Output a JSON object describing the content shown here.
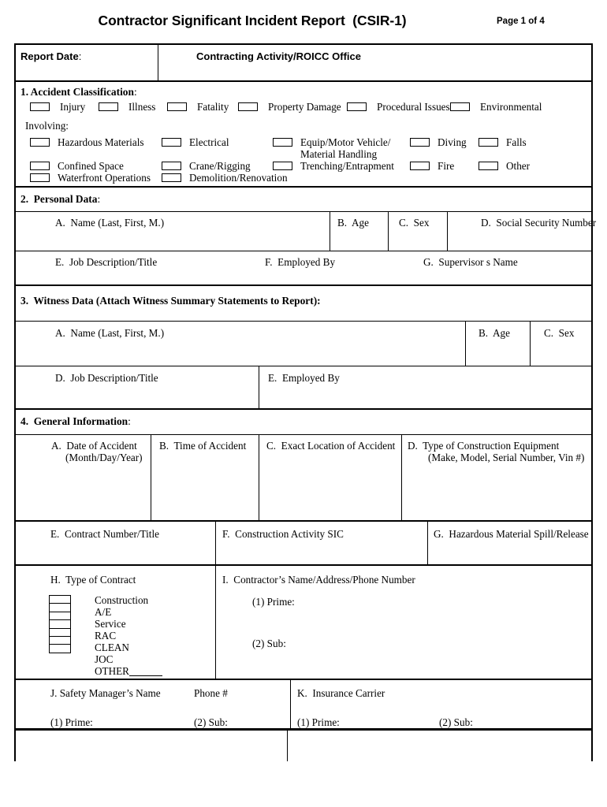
{
  "header": {
    "title": "Contractor Significant Incident Report  (CSIR-1)",
    "page_label": "Page 1 of 4"
  },
  "top_strip": {
    "report_date_label": "Report Date",
    "report_date_colon": ":",
    "contracting_activity_label": "Contracting Activity/ROICC Office"
  },
  "section1": {
    "number": "1.",
    "title": "Accident Classification",
    "colon": ":",
    "classification_boxes": [
      "Injury",
      "Illness",
      "Fatality",
      "Property Damage",
      "Procedural Issues",
      "Environmental"
    ],
    "involving_label": "Involving:",
    "involving_boxes": [
      "Hazardous Materials",
      "Electrical",
      "Equip/Motor Vehicle/",
      "Diving",
      "Falls",
      "Confined Space",
      "Crane/Rigging",
      "Trenching/Entrapment",
      "Fire",
      "Other",
      "Waterfront Operations",
      "Demolition/Renovation"
    ],
    "equip_second_line": "Material Handling"
  },
  "section2": {
    "number": "2.",
    "title": "Personal Data",
    "colon": ":",
    "row1": [
      "A.  Name (Last, First, M.)",
      "B.  Age",
      "C.  Sex",
      "D.  Social Security Number"
    ],
    "row2": [
      "E.  Job Description/Title",
      "F.  Employed By",
      "G.  Supervisor s Name"
    ]
  },
  "section3": {
    "number": "3.",
    "title": "Witness Data (Attach Witness Summary Statements to Report):",
    "row1": [
      "A.  Name (Last, First, M.)",
      "B.  Age",
      "C.  Sex"
    ],
    "row2": [
      "D.  Job Description/Title",
      "E.  Employed By"
    ]
  },
  "section4": {
    "number": "4.",
    "title": "General Information",
    "colon": ":",
    "rowA": {
      "a_line1": "A.  Date of Accident",
      "a_line2": "(Month/Day/Year)",
      "b": "B.  Time of Accident",
      "c": "C.  Exact Location of Accident",
      "d_line1": "D.  Type of Construction Equipment",
      "d_line2": "(Make, Model, Serial Number, Vin #)"
    },
    "rowE": {
      "e": "E.  Contract Number/Title",
      "f": "F.  Construction Activity SIC",
      "g": "G.  Hazardous Material Spill/Release"
    },
    "rowH": {
      "h": "H.  Type of Contract",
      "i": "I.  Contractor’s Name/Address/Phone Number",
      "i_prime": "(1) Prime:",
      "i_sub": "(2) Sub:",
      "contract_types": [
        "Construction",
        "A/E",
        "Service",
        "RAC",
        "CLEAN",
        "JOC",
        "OTHER"
      ]
    },
    "rowJ": {
      "j": "J. Safety Manager’s Name",
      "j_phone": "Phone #",
      "j_prime": "(1) Prime:",
      "j_sub": "(2) Sub:",
      "k": "K.  Insurance Carrier",
      "k_prime": "(1) Prime:",
      "k_sub": "(2) Sub:"
    }
  },
  "colors": {
    "ink": "#000000",
    "paper": "#ffffff"
  }
}
